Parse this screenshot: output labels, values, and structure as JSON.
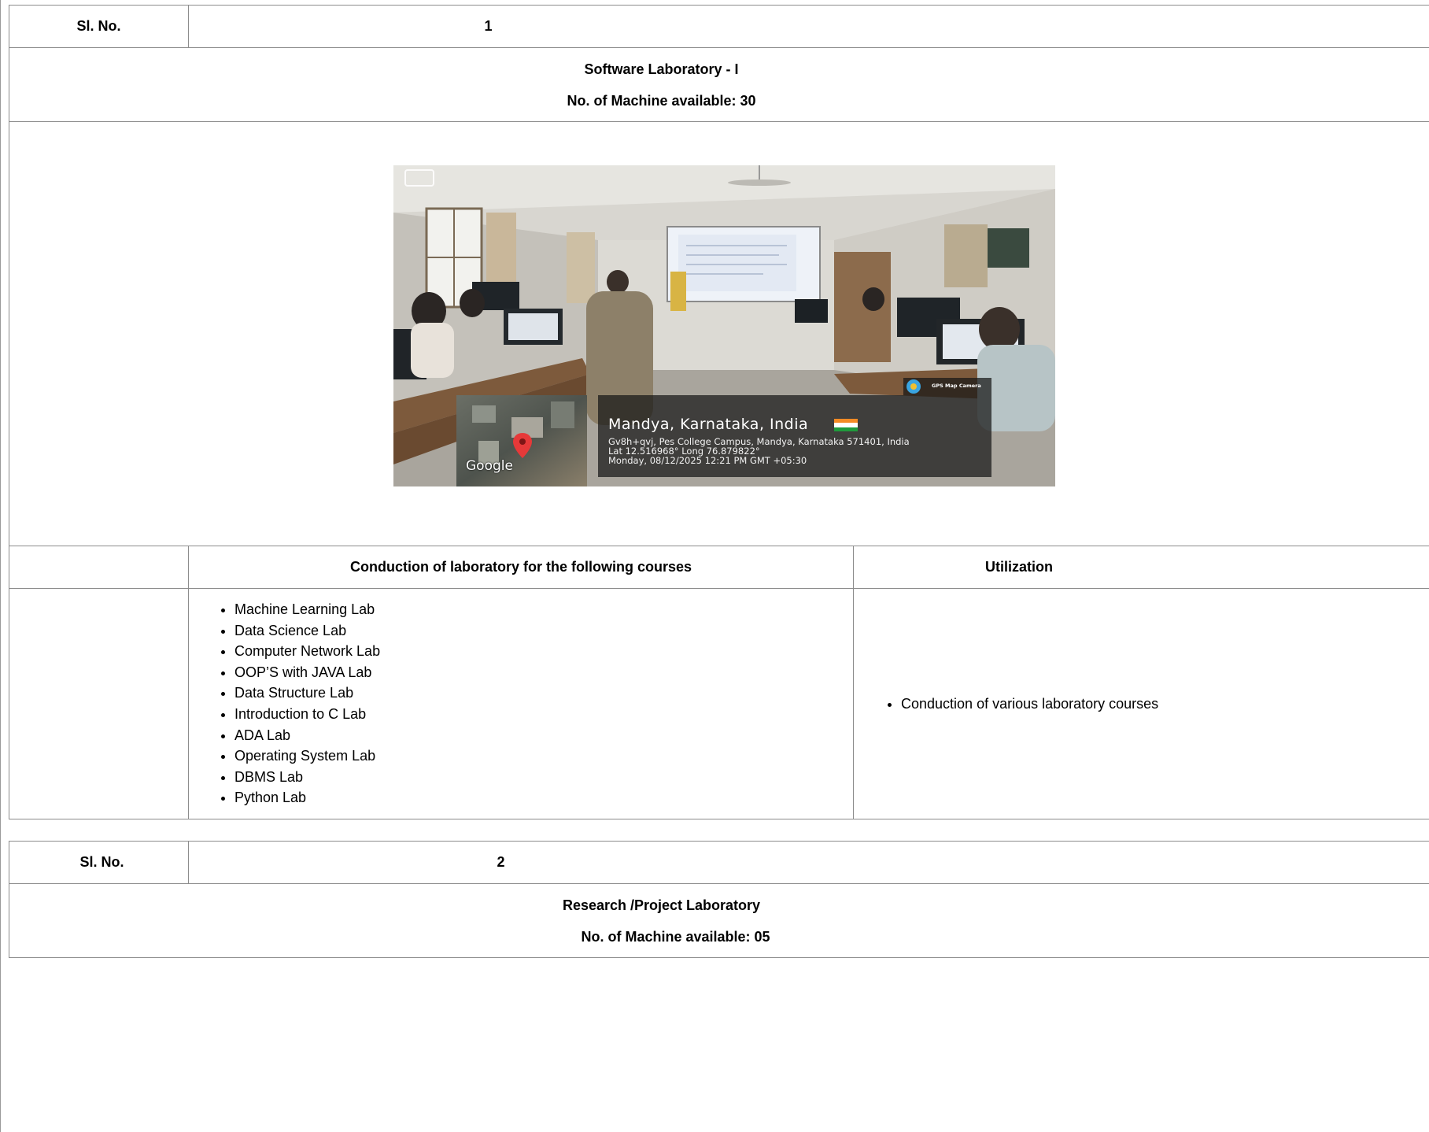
{
  "labs": [
    {
      "sl_label": "Sl. No.",
      "sl_value": "1",
      "name": "Software Laboratory - I",
      "machines": "No. of Machine available: 30",
      "photo": {
        "location_title": "Mandya, Karnataka, India",
        "address": "Gv8h+qvj, Pes College Campus, Mandya, Karnataka 571401, India",
        "coords": "Lat 12.516968° Long 76.879822°",
        "datetime": "Monday, 08/12/2025 12:21 PM GMT +05:30",
        "map_brand": "Google",
        "app_badge": "GPS Map Camera"
      },
      "courses_header": "Conduction of laboratory for the following courses",
      "utilization_header": "Utilization",
      "courses": [
        "Machine Learning Lab",
        "Data Science Lab",
        "Computer Network Lab",
        "OOP’S with JAVA Lab",
        "Data Structure Lab",
        "Introduction to C Lab",
        "ADA Lab",
        "Operating System Lab",
        "DBMS Lab",
        "Python Lab"
      ],
      "utilization": [
        "Conduction of various laboratory courses"
      ]
    },
    {
      "sl_label": "Sl. No.",
      "sl_value": "2",
      "name": "Research /Project Laboratory",
      "machines": "No. of Machine available: 05"
    }
  ]
}
